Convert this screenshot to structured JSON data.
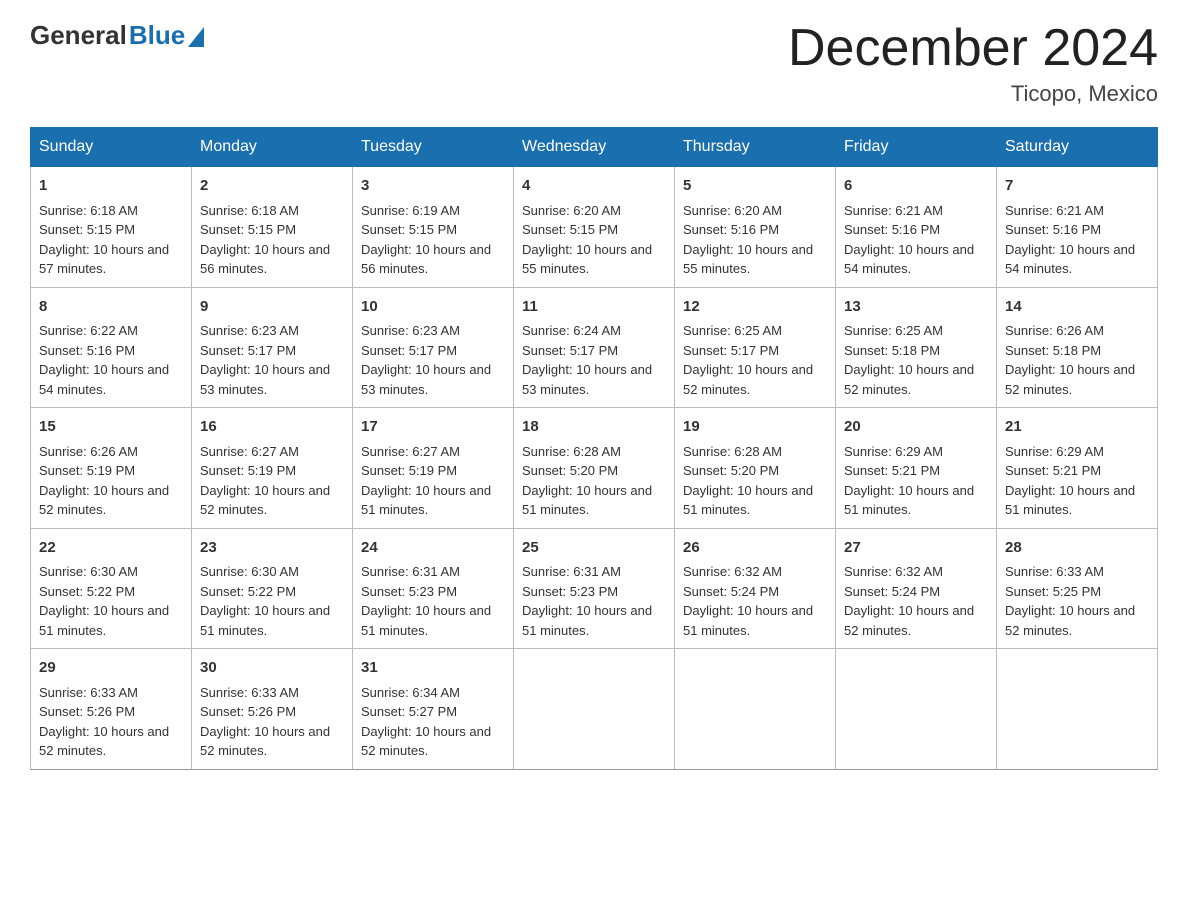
{
  "header": {
    "logo": {
      "general": "General",
      "blue": "Blue"
    },
    "title": "December 2024",
    "location": "Ticopo, Mexico"
  },
  "days": [
    "Sunday",
    "Monday",
    "Tuesday",
    "Wednesday",
    "Thursday",
    "Friday",
    "Saturday"
  ],
  "weeks": [
    [
      {
        "day": 1,
        "sunrise": "6:18 AM",
        "sunset": "5:15 PM",
        "daylight": "10 hours and 57 minutes."
      },
      {
        "day": 2,
        "sunrise": "6:18 AM",
        "sunset": "5:15 PM",
        "daylight": "10 hours and 56 minutes."
      },
      {
        "day": 3,
        "sunrise": "6:19 AM",
        "sunset": "5:15 PM",
        "daylight": "10 hours and 56 minutes."
      },
      {
        "day": 4,
        "sunrise": "6:20 AM",
        "sunset": "5:15 PM",
        "daylight": "10 hours and 55 minutes."
      },
      {
        "day": 5,
        "sunrise": "6:20 AM",
        "sunset": "5:16 PM",
        "daylight": "10 hours and 55 minutes."
      },
      {
        "day": 6,
        "sunrise": "6:21 AM",
        "sunset": "5:16 PM",
        "daylight": "10 hours and 54 minutes."
      },
      {
        "day": 7,
        "sunrise": "6:21 AM",
        "sunset": "5:16 PM",
        "daylight": "10 hours and 54 minutes."
      }
    ],
    [
      {
        "day": 8,
        "sunrise": "6:22 AM",
        "sunset": "5:16 PM",
        "daylight": "10 hours and 54 minutes."
      },
      {
        "day": 9,
        "sunrise": "6:23 AM",
        "sunset": "5:17 PM",
        "daylight": "10 hours and 53 minutes."
      },
      {
        "day": 10,
        "sunrise": "6:23 AM",
        "sunset": "5:17 PM",
        "daylight": "10 hours and 53 minutes."
      },
      {
        "day": 11,
        "sunrise": "6:24 AM",
        "sunset": "5:17 PM",
        "daylight": "10 hours and 53 minutes."
      },
      {
        "day": 12,
        "sunrise": "6:25 AM",
        "sunset": "5:17 PM",
        "daylight": "10 hours and 52 minutes."
      },
      {
        "day": 13,
        "sunrise": "6:25 AM",
        "sunset": "5:18 PM",
        "daylight": "10 hours and 52 minutes."
      },
      {
        "day": 14,
        "sunrise": "6:26 AM",
        "sunset": "5:18 PM",
        "daylight": "10 hours and 52 minutes."
      }
    ],
    [
      {
        "day": 15,
        "sunrise": "6:26 AM",
        "sunset": "5:19 PM",
        "daylight": "10 hours and 52 minutes."
      },
      {
        "day": 16,
        "sunrise": "6:27 AM",
        "sunset": "5:19 PM",
        "daylight": "10 hours and 52 minutes."
      },
      {
        "day": 17,
        "sunrise": "6:27 AM",
        "sunset": "5:19 PM",
        "daylight": "10 hours and 51 minutes."
      },
      {
        "day": 18,
        "sunrise": "6:28 AM",
        "sunset": "5:20 PM",
        "daylight": "10 hours and 51 minutes."
      },
      {
        "day": 19,
        "sunrise": "6:28 AM",
        "sunset": "5:20 PM",
        "daylight": "10 hours and 51 minutes."
      },
      {
        "day": 20,
        "sunrise": "6:29 AM",
        "sunset": "5:21 PM",
        "daylight": "10 hours and 51 minutes."
      },
      {
        "day": 21,
        "sunrise": "6:29 AM",
        "sunset": "5:21 PM",
        "daylight": "10 hours and 51 minutes."
      }
    ],
    [
      {
        "day": 22,
        "sunrise": "6:30 AM",
        "sunset": "5:22 PM",
        "daylight": "10 hours and 51 minutes."
      },
      {
        "day": 23,
        "sunrise": "6:30 AM",
        "sunset": "5:22 PM",
        "daylight": "10 hours and 51 minutes."
      },
      {
        "day": 24,
        "sunrise": "6:31 AM",
        "sunset": "5:23 PM",
        "daylight": "10 hours and 51 minutes."
      },
      {
        "day": 25,
        "sunrise": "6:31 AM",
        "sunset": "5:23 PM",
        "daylight": "10 hours and 51 minutes."
      },
      {
        "day": 26,
        "sunrise": "6:32 AM",
        "sunset": "5:24 PM",
        "daylight": "10 hours and 51 minutes."
      },
      {
        "day": 27,
        "sunrise": "6:32 AM",
        "sunset": "5:24 PM",
        "daylight": "10 hours and 52 minutes."
      },
      {
        "day": 28,
        "sunrise": "6:33 AM",
        "sunset": "5:25 PM",
        "daylight": "10 hours and 52 minutes."
      }
    ],
    [
      {
        "day": 29,
        "sunrise": "6:33 AM",
        "sunset": "5:26 PM",
        "daylight": "10 hours and 52 minutes."
      },
      {
        "day": 30,
        "sunrise": "6:33 AM",
        "sunset": "5:26 PM",
        "daylight": "10 hours and 52 minutes."
      },
      {
        "day": 31,
        "sunrise": "6:34 AM",
        "sunset": "5:27 PM",
        "daylight": "10 hours and 52 minutes."
      },
      null,
      null,
      null,
      null
    ]
  ],
  "labels": {
    "sunrise": "Sunrise:",
    "sunset": "Sunset:",
    "daylight": "Daylight:"
  }
}
